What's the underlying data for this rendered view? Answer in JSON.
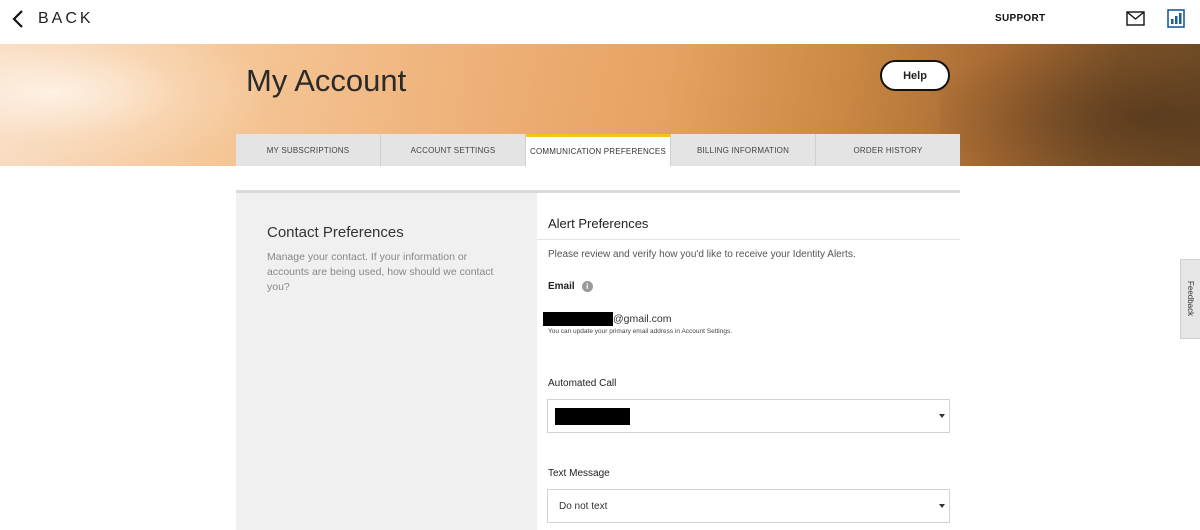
{
  "header": {
    "back_label": "BACK",
    "support_label": "SUPPORT",
    "icons": [
      "chevron-left-icon",
      "mail-icon",
      "report-icon"
    ]
  },
  "hero": {
    "title": "My Account",
    "help_label": "Help"
  },
  "tabs": [
    {
      "label": "MY SUBSCRIPTIONS",
      "active": false
    },
    {
      "label": "ACCOUNT SETTINGS",
      "active": false
    },
    {
      "label": "COMMUNICATION PREFERENCES",
      "active": true
    },
    {
      "label": "BILLING INFORMATION",
      "active": false
    },
    {
      "label": "ORDER HISTORY",
      "active": false
    }
  ],
  "contact_preferences": {
    "title": "Contact Preferences",
    "description": "Manage your contact. If your information or accounts are being used, how should we contact you?"
  },
  "alert_preferences": {
    "title": "Alert Preferences",
    "description": "Please review and verify how you'd like to receive your Identity Alerts.",
    "email_label": "Email",
    "email_domain": "@gmail.com",
    "email_note": "You can update your primary email address in Account Settings.",
    "call_label": "Automated Call",
    "text_label": "Text Message",
    "text_value": "Do not text"
  },
  "feedback_label": "Feedback",
  "colors": {
    "active_tab_accent": "#f2c418",
    "tab_background": "#e4e4e4",
    "left_panel_background": "#f0f0f0"
  }
}
